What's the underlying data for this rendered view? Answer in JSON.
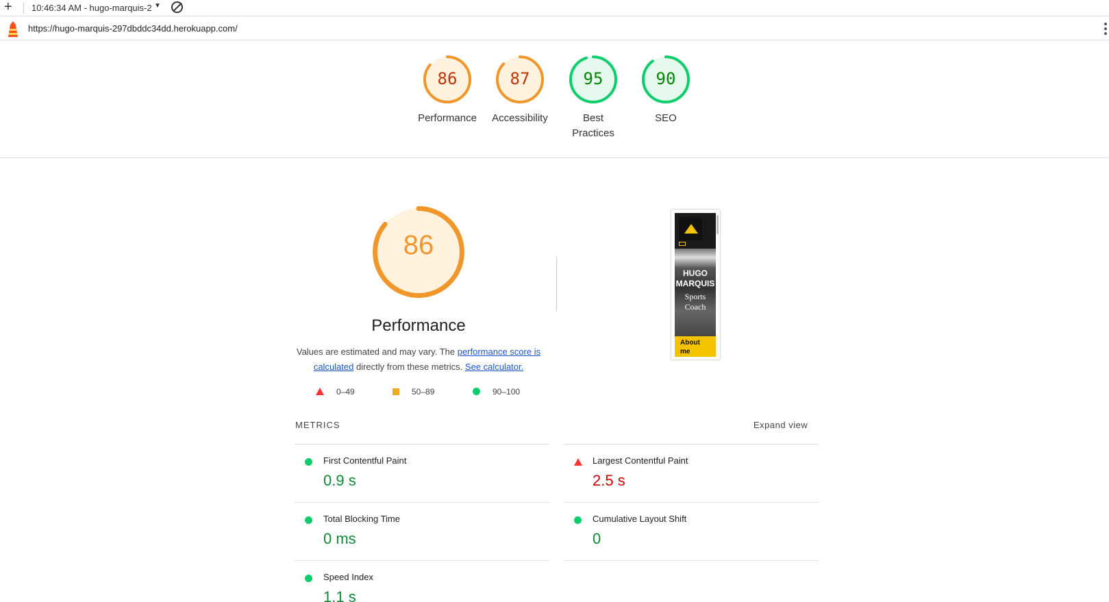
{
  "toolbar": {
    "new_icon": "plus-icon",
    "session_title": "10:46:34 AM - hugo-marquis-2",
    "dropdown_icon": "caret-down-icon",
    "clear_icon": "block-icon"
  },
  "urlbar": {
    "icon": "lighthouse-icon",
    "url": "https://hugo-marquis-297dbddc34dd.herokuapp.com/",
    "menu_icon": "kebab-menu-icon"
  },
  "scores": [
    {
      "label": "Performance",
      "value": 86,
      "color": "#f0962a",
      "text_color": "#c33300",
      "fill": "#fff3e0"
    },
    {
      "label": "Accessibility",
      "value": 87,
      "color": "#f0962a",
      "text_color": "#c33300",
      "fill": "#fff3e0"
    },
    {
      "label": "Best Practices",
      "value": 95,
      "color": "#0cce6b",
      "text_color": "#008800",
      "fill": "#e6f9ee"
    },
    {
      "label": "SEO",
      "value": 90,
      "color": "#0cce6b",
      "text_color": "#008800",
      "fill": "#e6f9ee"
    }
  ],
  "performance": {
    "score": 86,
    "title": "Performance",
    "desc_prefix": "Values are estimated and may vary. The ",
    "link1": "performance score is calculated",
    "desc_mid": " directly from these metrics. ",
    "link2": "See calculator."
  },
  "legend": {
    "fail": "0–49",
    "average": "50–89",
    "pass": "90–100"
  },
  "thumbnail": {
    "line1": "HUGO MARQUIS",
    "line2": "Sports Coach",
    "button": "About me"
  },
  "metrics": {
    "heading": "METRICS",
    "expand": "Expand view",
    "items": [
      {
        "name": "First Contentful Paint",
        "value": "0.9 s",
        "status": "pass"
      },
      {
        "name": "Largest Contentful Paint",
        "value": "2.5 s",
        "status": "fail"
      },
      {
        "name": "Total Blocking Time",
        "value": "0 ms",
        "status": "pass"
      },
      {
        "name": "Cumulative Layout Shift",
        "value": "0",
        "status": "pass"
      },
      {
        "name": "Speed Index",
        "value": "1.1 s",
        "status": "pass"
      }
    ]
  }
}
